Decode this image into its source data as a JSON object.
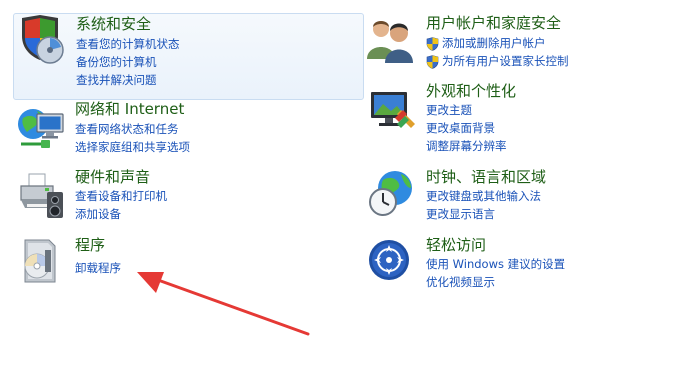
{
  "colors": {
    "title": "#1e5e16",
    "link": "#1a52b8",
    "hover_bg": "#eaf2fb",
    "hover_border": "#c9dcf1",
    "arrow": "#e53935"
  },
  "categories": [
    {
      "icon": "system-security-icon",
      "title": "系统和安全",
      "links": [
        "查看您的计算机状态",
        "备份您的计算机",
        "查找并解决问题"
      ]
    },
    {
      "icon": "network-internet-icon",
      "title": "网络和 Internet",
      "links": [
        "查看网络状态和任务",
        "选择家庭组和共享选项"
      ]
    },
    {
      "icon": "hardware-sound-icon",
      "title": "硬件和声音",
      "links": [
        "查看设备和打印机",
        "添加设备"
      ]
    },
    {
      "icon": "programs-icon",
      "title": "程序",
      "links": [
        "卸载程序"
      ]
    },
    {
      "icon": "user-accounts-icon",
      "title": "用户帐户和家庭安全",
      "links": [
        "添加或删除用户帐户",
        "为所有用户设置家长控制"
      ]
    },
    {
      "icon": "appearance-icon",
      "title": "外观和个性化",
      "links": [
        "更改主题",
        "更改桌面背景",
        "调整屏幕分辨率"
      ]
    },
    {
      "icon": "clock-language-region-icon",
      "title": "时钟、语言和区域",
      "links": [
        "更改键盘或其他输入法",
        "更改显示语言"
      ]
    },
    {
      "icon": "ease-of-access-icon",
      "title": "轻松访问",
      "links": [
        "使用 Windows 建议的设置",
        "优化视频显示"
      ]
    }
  ]
}
